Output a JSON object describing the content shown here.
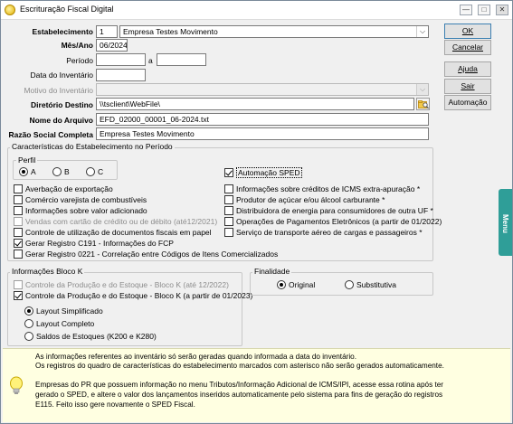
{
  "window": {
    "title": "Escrituração Fiscal Digital",
    "controls": {
      "minimize": "—",
      "maximize": "□",
      "close": "✕"
    }
  },
  "form": {
    "estabelecimento": {
      "label": "Estabelecimento",
      "code": "1",
      "name": "Empresa Testes Movimento"
    },
    "mes_ano": {
      "label": "Mês/Ano",
      "value": "06/2024"
    },
    "periodo": {
      "label": "Período",
      "from": "",
      "separator": "a",
      "to": ""
    },
    "data_inventario": {
      "label": "Data do Inventário",
      "value": ""
    },
    "motivo_inventario": {
      "label": "Motivo do Inventário",
      "value": ""
    },
    "diretorio_destino": {
      "label": "Diretório Destino",
      "value": "\\\\tsclient\\WebFile\\"
    },
    "nome_arquivo": {
      "label": "Nome do Arquivo",
      "value": "EFD_02000_00001_06-2024.txt"
    },
    "razao_social": {
      "label": "Razão Social Completa",
      "value": "Empresa Testes Movimento"
    }
  },
  "buttons": {
    "ok": "OK",
    "cancelar": "Cancelar",
    "ajuda": "Ajuda",
    "sair": "Sair",
    "automacao": "Automação"
  },
  "caracteristicas": {
    "title": "Características do Estabelecimento no Período",
    "perfil": {
      "title": "Perfil",
      "options": [
        "A",
        "B",
        "C"
      ],
      "selected": "A"
    },
    "automacao_sped": {
      "label": "Automação SPED",
      "checked": true
    },
    "left_items": [
      {
        "label": "Averbação de exportação",
        "checked": false,
        "disabled": false
      },
      {
        "label": "Comércio varejista de combustíveis",
        "checked": false,
        "disabled": false
      },
      {
        "label": "Informações sobre valor adicionado",
        "checked": false,
        "disabled": false
      },
      {
        "label": "Vendas com cartão de crédito ou de débito (até12/2021)",
        "checked": false,
        "disabled": true
      },
      {
        "label": "Controle de utilização de documentos fiscais em papel",
        "checked": false,
        "disabled": false
      },
      {
        "label": "Gerar Registro C191 - Informações do FCP",
        "checked": true,
        "disabled": false
      },
      {
        "label": "Gerar Registro 0221 - Correlação entre Códigos de Itens Comercializados",
        "checked": false,
        "disabled": false
      }
    ],
    "right_items": [
      {
        "label": "Informações sobre créditos de ICMS extra-apuração *",
        "checked": false
      },
      {
        "label": "Produtor de açúcar e/ou álcool carburante *",
        "checked": false
      },
      {
        "label": "Distribuidora de energia para consumidores de outra UF *",
        "checked": false
      },
      {
        "label": "Operações de Pagamentos Eletrônicos (a partir de 01/2022)",
        "checked": false
      },
      {
        "label": "Serviço de transporte aéreo de cargas e passageiros *",
        "checked": false
      }
    ]
  },
  "bloco_k": {
    "title": "Informações Bloco K",
    "items": [
      {
        "label": "Controle da Produção e do Estoque - Bloco K (até 12/2022)",
        "checked": false,
        "disabled": true
      },
      {
        "label": "Controle da Produção e do Estoque - Bloco K (a partir de 01/2023)",
        "checked": true,
        "disabled": false
      }
    ],
    "layouts": [
      "Layout Simplificado",
      "Layout Completo",
      "Saldos de Estoques (K200 e K280)"
    ],
    "selected_layout": "Layout Simplificado"
  },
  "finalidade": {
    "title": "Finalidade",
    "options": [
      "Original",
      "Substitutiva"
    ],
    "selected": "Original"
  },
  "info": {
    "line1": "As informações referentes ao inventário só serão geradas quando informada a data do inventário.",
    "line2": "Os registros do quadro de características do estabelecimento marcados com asterisco não serão gerados automaticamente.",
    "para2_line1": "Empresas do PR que possuem informação no menu Tributos/Informação Adicional de ICMS/IPI, acesse essa rotina após ter",
    "para2_line2": "gerado o SPED, e altere o valor dos lançamentos inseridos automaticamente pelo sistema para fins de geração do registros",
    "para2_line3": "E115. Feito isso gere novamente o SPED Fiscal."
  },
  "side_tab": {
    "label": "Menu"
  },
  "colors": {
    "accent": "#2f9e98",
    "info_bg": "#ffffe1",
    "window_bg": "#f0f0f0"
  }
}
